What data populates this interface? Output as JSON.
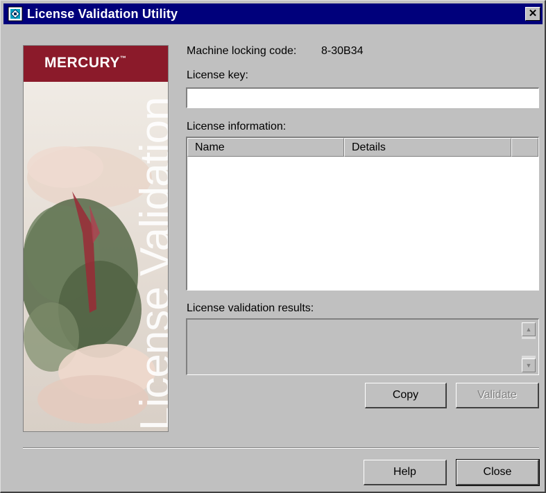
{
  "window": {
    "title": "License Validation Utility",
    "close_glyph": "✕",
    "icon": "license-app-icon"
  },
  "banner": {
    "logo": "MERCURY",
    "logo_tm": "™",
    "vertical_text": "License Validation"
  },
  "machine": {
    "label": "Machine locking code:",
    "value": "8-30B34"
  },
  "license_key": {
    "label": "License key:",
    "value": ""
  },
  "license_info": {
    "label": "License information:",
    "columns": [
      "Name",
      "Details",
      ""
    ]
  },
  "results": {
    "label": "License validation results:",
    "scroll_up": "▲",
    "scroll_down": "▼"
  },
  "buttons": {
    "copy": "Copy",
    "validate": "Validate",
    "help": "Help",
    "close": "Close"
  },
  "colors": {
    "titlebar": "#00007b",
    "brand": "#8b1a2a",
    "face": "#c0c0c0"
  }
}
